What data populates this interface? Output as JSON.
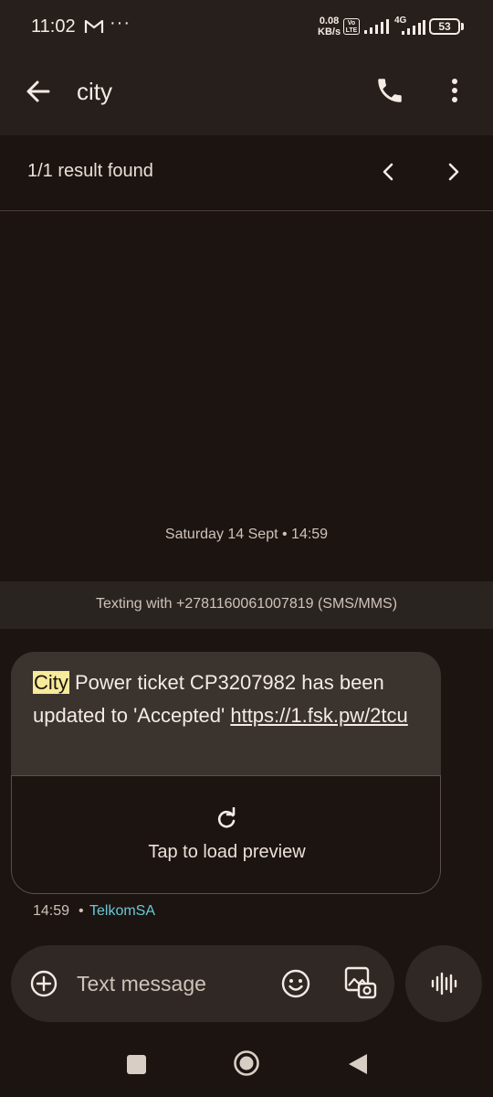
{
  "status_bar": {
    "time": "11:02",
    "more": "···",
    "speed_value": "0.08",
    "speed_unit": "KB/s",
    "volte": "Vo LTE",
    "network": "4G",
    "battery": "53"
  },
  "header": {
    "query": "city"
  },
  "search_results": {
    "label": "1/1 result found"
  },
  "conversation": {
    "date": "Saturday 14 Sept • 14:59",
    "texting_with": "Texting with +2781160061007819 (SMS/MMS)",
    "message": {
      "highlight": "City",
      "body": " Power ticket CP3207982 has been updated to 'Accepted' ",
      "link": "https://1.fsk.pw/2tcu",
      "preview_label": "Tap to load preview",
      "time": "14:59",
      "separator": "•",
      "sender": "TelkomSA"
    }
  },
  "composer": {
    "placeholder": "Text message"
  },
  "colors": {
    "background": "#1b1410",
    "bubble": "#3a332e",
    "highlight": "#f7ea9a",
    "sender_link": "#6cc7d9"
  }
}
